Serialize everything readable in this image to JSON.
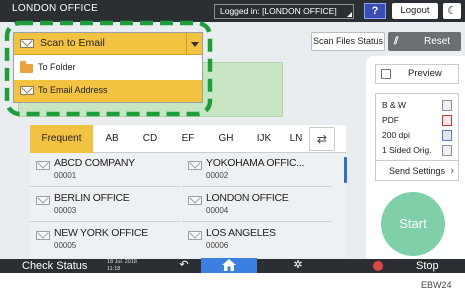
{
  "topbar": {
    "office": "LONDON OFFICE",
    "login_status": "Logged in: [LONDON OFFICE]",
    "help": "?",
    "logout": "Logout",
    "sleep": "☾"
  },
  "toolbar": {
    "scan_files_status": "Scan Files Status",
    "reset": "Reset"
  },
  "dropdown": {
    "selected": "Scan to Email",
    "options": [
      {
        "label": "To Folder",
        "icon": "folder-icon"
      },
      {
        "label": "To Email Address",
        "icon": "envelope-icon"
      }
    ]
  },
  "tabs": [
    {
      "label": "Frequent",
      "active": true
    },
    {
      "label": "AB"
    },
    {
      "label": "CD"
    },
    {
      "label": "EF"
    },
    {
      "label": "GH"
    },
    {
      "label": "IJK"
    },
    {
      "label": "LN"
    }
  ],
  "destinations": [
    {
      "name": "ABCD COMPANY",
      "number": "00001"
    },
    {
      "name": "YOKOHAMA OFFIC...",
      "number": "00002"
    },
    {
      "name": "BERLIN OFFICE",
      "number": "00003"
    },
    {
      "name": "LONDON OFFICE",
      "number": "00004"
    },
    {
      "name": "NEW YORK OFFICE",
      "number": "00005"
    },
    {
      "name": "LOS ANGELES",
      "number": "00006"
    }
  ],
  "settings": {
    "preview": "Preview",
    "color": "B & W",
    "format": "PDF",
    "resolution": "200 dpi",
    "sides": "1 Sided Orig.",
    "send_settings": "Send Settings"
  },
  "start": "Start",
  "bottombar": {
    "check_status": "Check Status",
    "date": "18 Jul. 2018",
    "time": "11:18",
    "stop": "Stop"
  },
  "caption": "EBW24",
  "colors": {
    "accent_yellow": "#f2c241",
    "highlight_green": "#1e9e3a",
    "start_green": "#7fcfa9",
    "home_blue": "#3b7fe0"
  }
}
